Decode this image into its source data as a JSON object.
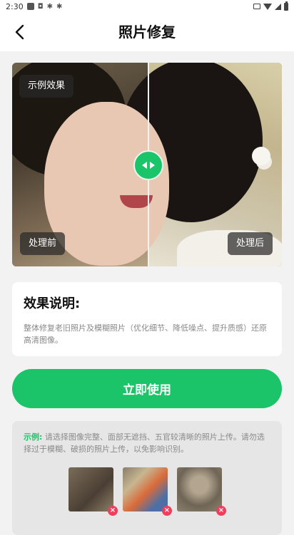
{
  "status_bar": {
    "time": "2:30",
    "icons": [
      "notification-square-icon",
      "notification-app-icon",
      "notification-bug-icon",
      "notification-bug-icon",
      "vibrate-icon",
      "wifi-icon",
      "signal-icon",
      "battery-icon"
    ]
  },
  "header": {
    "title": "照片修复",
    "back_icon": "chevron-left-icon"
  },
  "preview": {
    "example_tag": "示例效果",
    "before_label": "处理前",
    "after_label": "处理后",
    "handle_icon": "compare-arrows-icon",
    "accent_color": "#1bc468"
  },
  "info": {
    "title": "效果说明:",
    "description": "整体修复老旧照片及模糊照片（优化细节、降低噪点、提升质感）还原高清图像。"
  },
  "primary_action": {
    "label": "立即使用"
  },
  "tips": {
    "label": "示例:",
    "text": " 请选择图像完整、面部无遮挡、五官较清晰的照片上传。请勿选择过于模糊、破损的照片上传，以免影响识别。",
    "samples": [
      {
        "icon": "remove-icon",
        "mark": "×"
      },
      {
        "icon": "remove-icon",
        "mark": "×"
      },
      {
        "icon": "remove-icon",
        "mark": "×"
      }
    ]
  },
  "colors": {
    "accent": "#1bc468",
    "error": "#f23d5c",
    "background": "#f2f2f2"
  }
}
